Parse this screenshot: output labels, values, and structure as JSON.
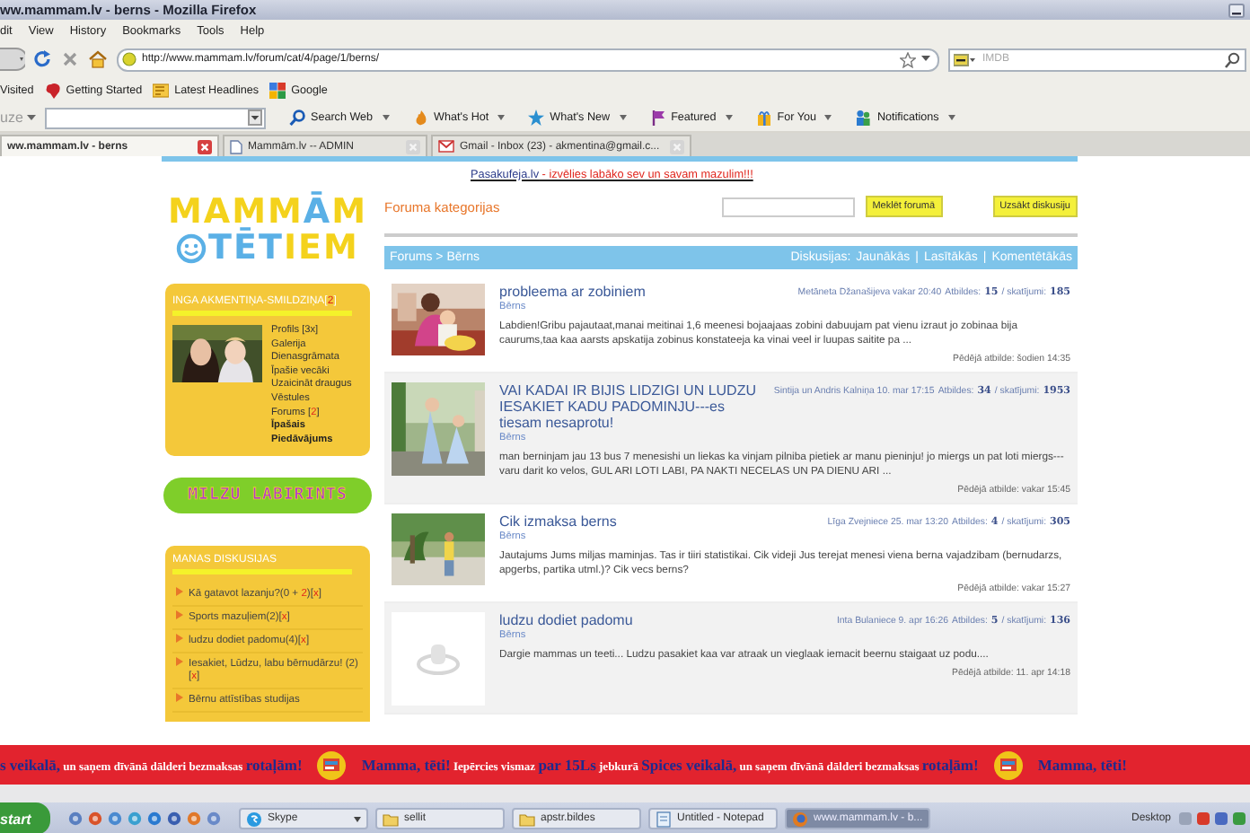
{
  "window": {
    "title": "ww.mammam.lv - berns - Mozilla Firefox"
  },
  "menu": [
    "dit",
    "View",
    "History",
    "Bookmarks",
    "Tools",
    "Help"
  ],
  "address": {
    "url": "http://www.mammam.lv/forum/cat/4/page/1/berns/"
  },
  "search_engine": {
    "placeholder": "IMDB"
  },
  "bookmarks": [
    {
      "label": "Visited",
      "kind": "plain"
    },
    {
      "label": "Getting Started",
      "kind": "start"
    },
    {
      "label": "Latest Headlines",
      "kind": "feed"
    },
    {
      "label": "Google",
      "kind": "squares"
    }
  ],
  "toolbar": {
    "field_label": "uze",
    "items": [
      {
        "label": "Search Web",
        "kind": "search"
      },
      {
        "label": "What's Hot",
        "kind": "flame"
      },
      {
        "label": "What's New",
        "kind": "star"
      },
      {
        "label": "Featured",
        "kind": "flag"
      },
      {
        "label": "For You",
        "kind": "gift"
      },
      {
        "label": "Notifications",
        "kind": "people"
      }
    ]
  },
  "tabs": [
    {
      "label": "ww.mammam.lv - berns",
      "selected": true
    },
    {
      "label": "Mammām.lv -- ADMIN",
      "selected": false
    },
    {
      "label": "Gmail - Inbox (23) - akmentina@gmail.c...",
      "selected": false
    }
  ],
  "logo": {
    "lines": [
      [
        {
          "text": "MAMM",
          "accent": false
        },
        {
          "text": "Ā",
          "accent": true
        },
        {
          "text": "M",
          "accent": false
        }
      ],
      [
        {
          "text": "TĒT",
          "accent": true
        },
        {
          "text": "IEM",
          "accent": false
        }
      ]
    ]
  },
  "profile": {
    "name": [
      {
        "text": "INGA AKMENTIŅA-SMILDZIŅA[",
        "accent": false
      },
      {
        "text": "2",
        "accent": true
      },
      {
        "text": "]",
        "accent": false
      }
    ],
    "links": [
      {
        "segments": [
          {
            "text": "Profils [3x]",
            "accent": false
          }
        ],
        "bold": false
      },
      {
        "segments": [
          {
            "text": "Galerija",
            "accent": false
          }
        ],
        "bold": false
      },
      {
        "segments": [
          {
            "text": "Dienasgrāmata",
            "accent": false
          }
        ],
        "bold": false
      },
      {
        "segments": [
          {
            "text": "Īpašie vecāki",
            "accent": false
          }
        ],
        "bold": false
      },
      {
        "segments": [
          {
            "text": "Uzaicināt draugus",
            "accent": false
          }
        ],
        "bold": false
      },
      {
        "segments": [
          {
            "text": "Vēstules",
            "accent": false
          }
        ],
        "bold": false
      },
      {
        "segments": [
          {
            "text": "Forums [",
            "accent": false
          },
          {
            "text": "2",
            "accent": true
          },
          {
            "text": "]",
            "accent": false
          }
        ],
        "bold": false
      },
      {
        "segments": [
          {
            "text": "Īpašais Piedāvājums",
            "accent": false
          }
        ],
        "bold": true
      }
    ]
  },
  "promo": {
    "text": "MILZU LABIRINTS"
  },
  "discussions": {
    "title": "MANAS DISKUSIJAS",
    "items": [
      [
        {
          "text": "Kā gatavot lazanju?(0 + ",
          "accent": false
        },
        {
          "text": "2",
          "accent": true
        },
        {
          "text": ")[",
          "accent": false
        },
        {
          "text": "x",
          "accent": true
        },
        {
          "text": "]",
          "accent": false
        }
      ],
      [
        {
          "text": "Sports mazuļiem(2)[",
          "accent": false
        },
        {
          "text": "x",
          "accent": true
        },
        {
          "text": "]",
          "accent": false
        }
      ],
      [
        {
          "text": "ludzu dodiet padomu(4)[",
          "accent": false
        },
        {
          "text": "x",
          "accent": true
        },
        {
          "text": "]",
          "accent": false
        }
      ],
      [
        {
          "text": "Iesakiet, Lūdzu, labu bērnudārzu! (2)[",
          "accent": false
        },
        {
          "text": "x",
          "accent": true
        },
        {
          "text": "]",
          "accent": false
        }
      ],
      [
        {
          "text": "Bērnu attīstības studijas",
          "accent": false
        }
      ]
    ]
  },
  "ad_link": [
    {
      "text": "Pasakufeja.lv",
      "accent": false
    },
    {
      "text": " - izvēlies labāko sev un savam mazulim!!!",
      "accent": true
    }
  ],
  "forum": {
    "heading": "Foruma kategorijas",
    "search_button": "Meklēt forumā",
    "new_button": "Uzsākt diskusiju",
    "breadcrumb": "Forums > Bērns",
    "sort_label": "Diskusijas:",
    "separator": "|",
    "sorts": [
      "Jaunākās",
      "Lasītākās",
      "Komentētākās"
    ]
  },
  "posts": [
    {
      "title": "probleema ar zobiniem",
      "category": "Bērns",
      "author": "Metāneta Džanašijeva vakar 20:40",
      "replies_label": "Atbildes:",
      "replies": "15",
      "views_label": "/ skatījumi:",
      "views": "185",
      "excerpt": "Labdien!Gribu pajautaat,manai meitinai 1,6 meenesi bojaajaas zobini dabuujam pat vienu izraut jo zobinaa bija caurums,taa kaa aarsts apskatija zobinus konstateeja ka vinai veel ir luupas saitite pa ...",
      "last_reply": "Pēdējā atbilde: šodien 14:35"
    },
    {
      "title": "VAI KADAI IR BIJIS LIDZIGI UN LUDZU IESAKIET KADU PADOMINJU---es tiesam nesaprotu!",
      "category": "Bērns",
      "author": "Sintija un Andris Kalniņa 10. mar 17:15",
      "replies_label": "Atbildes:",
      "replies": "34",
      "views_label": "/ skatījumi:",
      "views": "1953",
      "excerpt": "man berninjam jau 13 bus 7 menesishi un liekas ka vinjam pilniba pietiek ar manu pieninju! jo miergs un pat loti miergs---varu darit ko velos, GUL ARI LOTI LABI, PA NAKTI NECELAS UN PA DIENU ARI ...",
      "last_reply": "Pēdējā atbilde: vakar 15:45"
    },
    {
      "title": "Cik izmaksa berns",
      "category": "Bērns",
      "author": "Līga Zvejniece 25. mar 13:20",
      "replies_label": "Atbildes:",
      "replies": "4",
      "views_label": "/ skatījumi:",
      "views": "305",
      "excerpt": "Jautajums Jums miljas maminjas. Tas ir tiiri statistikai. Cik videji Jus terejat menesi viena berna vajadzibam (bernudarzs, apgerbs, partika utml.)? Cik vecs berns?",
      "last_reply": "Pēdējā atbilde: vakar 15:27"
    },
    {
      "title": "ludzu dodiet padomu",
      "category": "Bērns",
      "author": "Inta Bulaniece 9. apr 16:26",
      "replies_label": "Atbildes:",
      "replies": "5",
      "views_label": "/ skatījumi:",
      "views": "136",
      "excerpt": "Dargie mammas un teeti... Ludzu pasakiet kaa var atraak un vieglaak iemacit beernu staigaat uz podu....",
      "last_reply": "Pēdējā atbilde: 11. apr 14:18",
      "thumbnail": {
        "kind": "placeholder"
      }
    }
  ],
  "banner": [
    {
      "kind": "text",
      "segments": [
        {
          "text": "s veikalā,",
          "accent": true
        },
        {
          "text": " un saņem dīvānā dālderi bezmaksas ",
          "accent": false
        },
        {
          "text": "rotaļām!",
          "accent": true
        }
      ]
    },
    {
      "kind": "icon"
    },
    {
      "kind": "text",
      "segments": [
        {
          "text": "Mamma, tēti!",
          "accent": true
        },
        {
          "text": " Iepērcies vismaz ",
          "accent": false
        },
        {
          "text": "par 15Ls",
          "accent": true
        },
        {
          "text": " jebkurā ",
          "accent": false
        },
        {
          "text": "Spices veikalā,",
          "accent": true
        },
        {
          "text": " un saņem dīvānā dālderi bezmaksas ",
          "accent": false
        },
        {
          "text": "rotaļām!",
          "accent": true
        }
      ]
    },
    {
      "kind": "icon"
    },
    {
      "kind": "text",
      "segments": [
        {
          "text": "Mamma, tēti!",
          "accent": true
        }
      ]
    }
  ],
  "taskbar": {
    "start": "start",
    "tasks": [
      {
        "label": "Skype",
        "kind": "skype",
        "selected": false
      },
      {
        "label": "sellit",
        "kind": "folder",
        "selected": false
      },
      {
        "label": "apstr.bildes",
        "kind": "folder",
        "selected": false
      },
      {
        "label": "Untitled - Notepad",
        "kind": "notepad",
        "selected": false
      },
      {
        "label": "www.mammam.lv - b...",
        "kind": "browser",
        "selected": true
      }
    ],
    "desktop": "Desktop"
  }
}
